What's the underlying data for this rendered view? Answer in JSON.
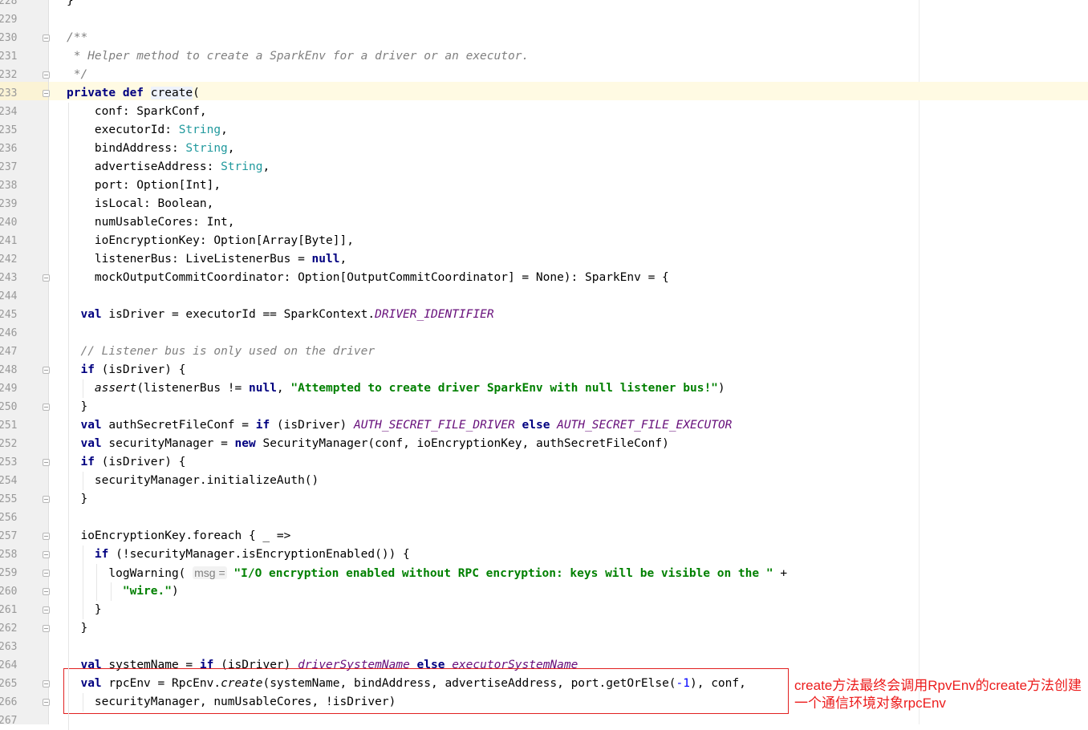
{
  "editor": {
    "line_numbers": [
      "228",
      "229",
      "230",
      "231",
      "232",
      "233",
      "234",
      "235",
      "236",
      "237",
      "238",
      "239",
      "240",
      "241",
      "242",
      "243",
      "244",
      "245",
      "246",
      "247",
      "248",
      "249",
      "250",
      "251",
      "252",
      "253",
      "254",
      "255",
      "256",
      "257",
      "258",
      "259",
      "260",
      "261",
      "262",
      "263",
      "264",
      "265",
      "266",
      "267"
    ],
    "lines": [
      [
        {
          "t": "}"
        }
      ],
      [],
      [
        {
          "t": "/**",
          "c": "cm"
        }
      ],
      [
        {
          "t": " * Helper method to create a SparkEnv for a driver or an executor.",
          "c": "cm"
        }
      ],
      [
        {
          "t": " */",
          "c": "cm"
        }
      ],
      [
        {
          "t": "private",
          "c": "kw"
        },
        {
          "t": " "
        },
        {
          "t": "def",
          "c": "kw"
        },
        {
          "t": " "
        },
        {
          "t": "create",
          "c": "hl-name"
        },
        {
          "t": "("
        }
      ],
      [
        {
          "t": "    conf: SparkConf,"
        }
      ],
      [
        {
          "t": "    executorId: "
        },
        {
          "t": "String",
          "c": "ty"
        },
        {
          "t": ","
        }
      ],
      [
        {
          "t": "    bindAddress: "
        },
        {
          "t": "String",
          "c": "ty"
        },
        {
          "t": ","
        }
      ],
      [
        {
          "t": "    advertiseAddress: "
        },
        {
          "t": "String",
          "c": "ty"
        },
        {
          "t": ","
        }
      ],
      [
        {
          "t": "    port: Option[Int],"
        }
      ],
      [
        {
          "t": "    isLocal: Boolean,"
        }
      ],
      [
        {
          "t": "    numUsableCores: Int,"
        }
      ],
      [
        {
          "t": "    ioEncryptionKey: Option[Array[Byte]],"
        }
      ],
      [
        {
          "t": "    listenerBus: LiveListenerBus = "
        },
        {
          "t": "null",
          "c": "kw"
        },
        {
          "t": ","
        }
      ],
      [
        {
          "t": "    mockOutputCommitCoordinator: Option[OutputCommitCoordinator] = None): SparkEnv = {"
        }
      ],
      [],
      [
        {
          "t": "  "
        },
        {
          "t": "val",
          "c": "kw"
        },
        {
          "t": " isDriver = executorId == SparkContext."
        },
        {
          "t": "DRIVER_IDENTIFIER",
          "c": "co"
        }
      ],
      [],
      [
        {
          "t": "  "
        },
        {
          "t": "// Listener bus is only used on the driver",
          "c": "cm"
        }
      ],
      [
        {
          "t": "  "
        },
        {
          "t": "if",
          "c": "kw"
        },
        {
          "t": " (isDriver) {"
        }
      ],
      [
        {
          "t": "    "
        },
        {
          "t": "assert",
          "c": "it"
        },
        {
          "t": "(listenerBus != "
        },
        {
          "t": "null",
          "c": "kw"
        },
        {
          "t": ", "
        },
        {
          "t": "\"Attempted to create driver SparkEnv with null listener bus!\"",
          "c": "st"
        },
        {
          "t": ")"
        }
      ],
      [
        {
          "t": "  }"
        }
      ],
      [
        {
          "t": "  "
        },
        {
          "t": "val",
          "c": "kw"
        },
        {
          "t": " authSecretFileConf = "
        },
        {
          "t": "if",
          "c": "kw"
        },
        {
          "t": " (isDriver) "
        },
        {
          "t": "AUTH_SECRET_FILE_DRIVER",
          "c": "co"
        },
        {
          "t": " "
        },
        {
          "t": "else",
          "c": "kw"
        },
        {
          "t": " "
        },
        {
          "t": "AUTH_SECRET_FILE_EXECUTOR",
          "c": "co"
        }
      ],
      [
        {
          "t": "  "
        },
        {
          "t": "val",
          "c": "kw"
        },
        {
          "t": " securityManager = "
        },
        {
          "t": "new",
          "c": "kw"
        },
        {
          "t": " SecurityManager(conf, ioEncryptionKey, authSecretFileConf)"
        }
      ],
      [
        {
          "t": "  "
        },
        {
          "t": "if",
          "c": "kw"
        },
        {
          "t": " (isDriver) {"
        }
      ],
      [
        {
          "t": "    securityManager.initializeAuth()"
        }
      ],
      [
        {
          "t": "  }"
        }
      ],
      [],
      [
        {
          "t": "  ioEncryptionKey.foreach { _ =>"
        }
      ],
      [
        {
          "t": "    "
        },
        {
          "t": "if",
          "c": "kw"
        },
        {
          "t": " (!securityManager.isEncryptionEnabled()) {"
        }
      ],
      [
        {
          "t": "      logWarning( "
        },
        {
          "t": "msg =",
          "c": "hint"
        },
        {
          "t": " "
        },
        {
          "t": "\"I/O encryption enabled without RPC encryption: keys will be visible on the \"",
          "c": "st"
        },
        {
          "t": " +"
        }
      ],
      [
        {
          "t": "        "
        },
        {
          "t": "\"wire.\"",
          "c": "st"
        },
        {
          "t": ")"
        }
      ],
      [
        {
          "t": "    }"
        }
      ],
      [
        {
          "t": "  }"
        }
      ],
      [],
      [
        {
          "t": "  "
        },
        {
          "t": "val",
          "c": "kw"
        },
        {
          "t": " systemName = "
        },
        {
          "t": "if",
          "c": "kw"
        },
        {
          "t": " (isDriver) "
        },
        {
          "t": "driverSystemName",
          "c": "co"
        },
        {
          "t": " "
        },
        {
          "t": "else",
          "c": "kw"
        },
        {
          "t": " "
        },
        {
          "t": "executorSystemName",
          "c": "co"
        }
      ],
      [
        {
          "t": "  "
        },
        {
          "t": "val",
          "c": "kw"
        },
        {
          "t": " rpcEnv = RpcEnv."
        },
        {
          "t": "create",
          "c": "it"
        },
        {
          "t": "(systemName, bindAddress, advertiseAddress, port.getOrElse("
        },
        {
          "t": "-1",
          "c": "num"
        },
        {
          "t": "), conf,"
        }
      ],
      [
        {
          "t": "    securityManager, numUsableCores, !isDriver)"
        }
      ],
      []
    ]
  },
  "annotation": {
    "text": "create方法最终会调用RpvEnv的create方法创建一个通信环境对象rpcEnv",
    "color": "#ec1c1c"
  }
}
